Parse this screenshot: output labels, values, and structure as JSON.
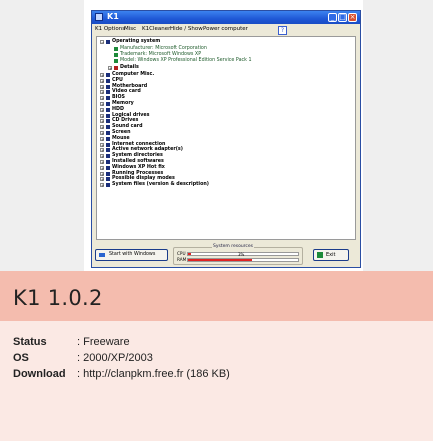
{
  "window": {
    "title": "K1",
    "menu": [
      "K1 Options",
      "Misc",
      "K1Cleaner",
      "Hide / Show",
      "Power computer",
      "?"
    ],
    "controls": {
      "minimize": "_",
      "maximize": "□",
      "close": "×"
    }
  },
  "tree": {
    "root": "Operating system",
    "os_details": [
      "Manufacturer: Microsoft Corporation",
      "Trademark: Microsoft Windows XP",
      "Model: Windows XP Professional Edition Service Pack 1"
    ],
    "details_label": "Details",
    "categories": [
      "Computer Misc.",
      "CPU",
      "Motherboard",
      "Video card",
      "BIOS",
      "Memory",
      "HDD",
      "Logical drives",
      "CD Drives",
      "Sound card",
      "Screen",
      "Mouse",
      "Internet connection",
      "Active network adapter(s)",
      "System directories",
      "Installed softwares",
      "Windows XP Hot fix",
      "Running Processes",
      "Possible display modes",
      "System files (version & description)"
    ],
    "expand_symbol": "+",
    "collapse_symbol": "−"
  },
  "bottom": {
    "start_button": "Start with Windows",
    "resources_title": "System resources",
    "cpu_label": "CPU",
    "ram_label": "RAM",
    "cpu_percent": 3,
    "ram_percent": 58,
    "cpu_text": "3%",
    "exit_button": "Exit",
    "bar_color": "#e02424"
  },
  "info": {
    "product_title": "K1 1.0.2",
    "rows": [
      {
        "key": "Status",
        "value": ": Freeware"
      },
      {
        "key": "OS",
        "value": ": 2000/XP/2003"
      },
      {
        "key": "Download",
        "value": ": http://clanpkm.free.fr (186 KB)"
      }
    ],
    "title_band_color": "#f4bcae",
    "info_band_color": "#fbe9e4"
  }
}
